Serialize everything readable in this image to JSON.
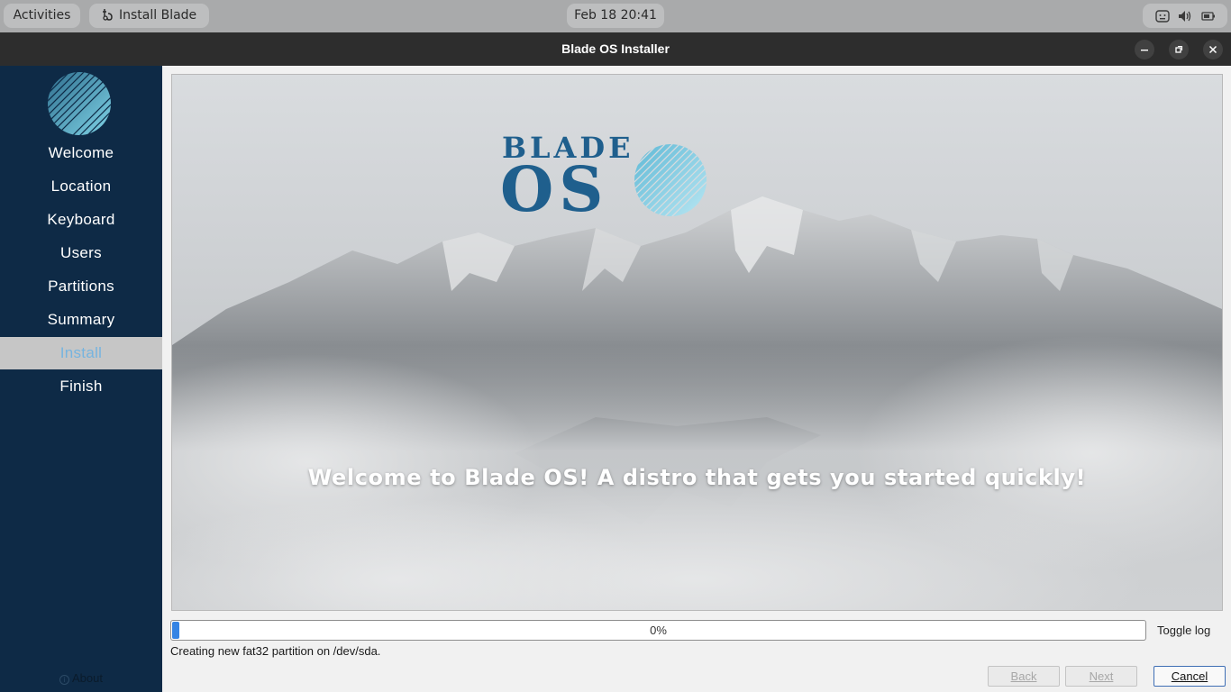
{
  "topbar": {
    "activities": "Activities",
    "app_name": "Install Blade",
    "clock": "Feb 18  20:41",
    "status_icons": [
      "accessibility-icon",
      "volume-icon",
      "battery-icon"
    ]
  },
  "window": {
    "title": "Blade OS Installer",
    "controls": [
      "minimize-icon",
      "restore-icon",
      "close-icon"
    ]
  },
  "sidebar": {
    "steps": [
      {
        "label": "Welcome",
        "active": false
      },
      {
        "label": "Location",
        "active": false
      },
      {
        "label": "Keyboard",
        "active": false
      },
      {
        "label": "Users",
        "active": false
      },
      {
        "label": "Partitions",
        "active": false
      },
      {
        "label": "Summary",
        "active": false
      },
      {
        "label": "Install",
        "active": true
      },
      {
        "label": "Finish",
        "active": false
      }
    ],
    "about_label": "About"
  },
  "slideshow": {
    "brand_word": "BLADE",
    "brand_os": "OS",
    "welcome_text": "Welcome to Blade OS! A distro that gets you started quickly!"
  },
  "install": {
    "progress_fraction": 0.0,
    "progress_text": "0%",
    "toggle_log_label": "Toggle log",
    "status_text": "Creating new fat32 partition on /dev/sda."
  },
  "buttons": {
    "back": "Back",
    "next": "Next",
    "cancel": "Cancel"
  },
  "colors": {
    "sidebar_bg": "#0e2a46",
    "active_step_bg": "#c6c6c6",
    "active_step_text": "#76b4df",
    "brand": "#1f5f8d",
    "progress_fill": "#3584e4"
  }
}
